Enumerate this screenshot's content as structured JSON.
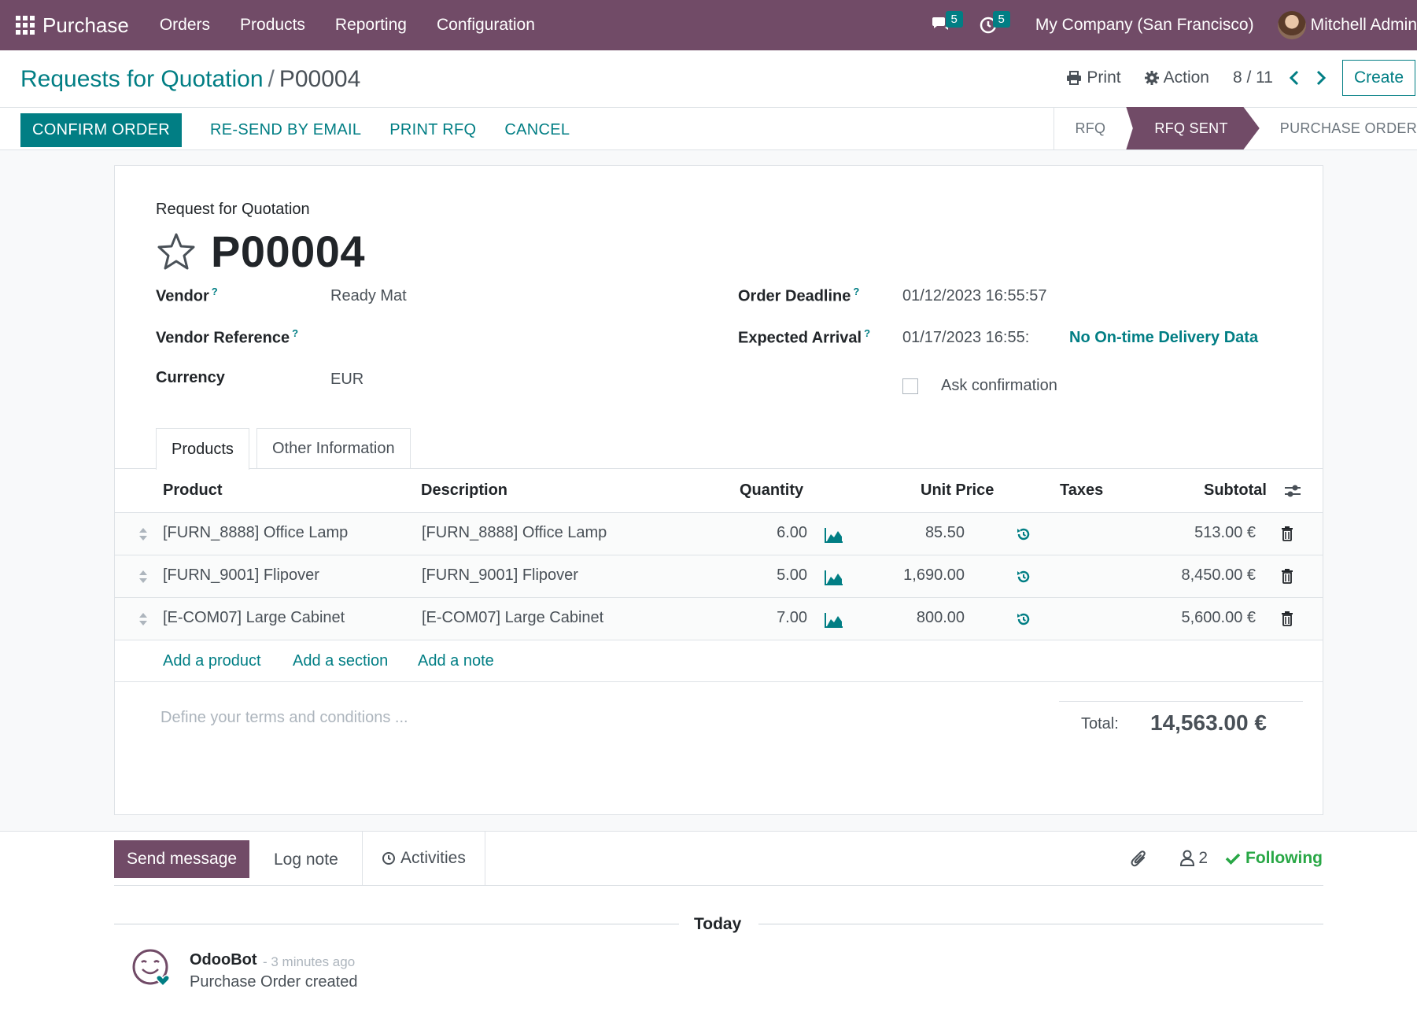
{
  "navbar": {
    "app_name": "Purchase",
    "menu": [
      "Orders",
      "Products",
      "Reporting",
      "Configuration"
    ],
    "messages_count": "5",
    "activities_count": "5",
    "company": "My Company (San Francisco)",
    "user": "Mitchell Admin"
  },
  "breadcrumb": {
    "parent": "Requests for Quotation",
    "separator": "/",
    "current": "P00004"
  },
  "control": {
    "print_label": "Print",
    "action_label": "Action",
    "pager": "8 / 11",
    "create_label": "Create"
  },
  "actions": {
    "confirm": "CONFIRM ORDER",
    "resend": "RE-SEND BY EMAIL",
    "print_rfq": "PRINT RFQ",
    "cancel": "CANCEL"
  },
  "statusbar": {
    "stages": [
      "RFQ",
      "RFQ SENT",
      "PURCHASE ORDER"
    ],
    "active": "RFQ SENT"
  },
  "form": {
    "doc_type": "Request for Quotation",
    "name": "P00004",
    "vendor_label": "Vendor",
    "vendor": "Ready Mat",
    "vendor_ref_label": "Vendor Reference",
    "vendor_ref": "",
    "currency_label": "Currency",
    "currency": "EUR",
    "deadline_label": "Order Deadline",
    "deadline": "01/12/2023 16:55:57",
    "arrival_label": "Expected Arrival",
    "arrival": "01/17/2023 16:55:",
    "ontime": "No On-time Delivery Data",
    "ask_confirmation_label": "Ask confirmation",
    "help_mark": "?"
  },
  "tabs": [
    "Products",
    "Other Information"
  ],
  "table": {
    "headers": {
      "product": "Product",
      "description": "Description",
      "quantity": "Quantity",
      "unit_price": "Unit Price",
      "taxes": "Taxes",
      "subtotal": "Subtotal"
    },
    "rows": [
      {
        "product": "[FURN_8888] Office Lamp",
        "description": "[FURN_8888] Office Lamp",
        "quantity": "6.00",
        "unit_price": "85.50",
        "taxes": "",
        "subtotal": "513.00 €"
      },
      {
        "product": "[FURN_9001] Flipover",
        "description": "[FURN_9001] Flipover",
        "quantity": "5.00",
        "unit_price": "1,690.00",
        "taxes": "",
        "subtotal": "8,450.00 €"
      },
      {
        "product": "[E-COM07] Large Cabinet",
        "description": "[E-COM07] Large Cabinet",
        "quantity": "7.00",
        "unit_price": "800.00",
        "taxes": "",
        "subtotal": "5,600.00 €"
      }
    ],
    "add_product": "Add a product",
    "add_section": "Add a section",
    "add_note": "Add a note"
  },
  "footer": {
    "terms_placeholder": "Define your terms and conditions ...",
    "total_label": "Total:",
    "total_value": "14,563.00 €"
  },
  "chatter": {
    "send_message": "Send message",
    "log_note": "Log note",
    "activities": "Activities",
    "followers_count": "2",
    "following": "Following",
    "date_separator": "Today",
    "messages": [
      {
        "author": "OdooBot",
        "time": "- 3 minutes ago",
        "body": "Purchase Order created"
      }
    ]
  },
  "colors": {
    "brand": "#714b67",
    "accent": "#017e84"
  }
}
